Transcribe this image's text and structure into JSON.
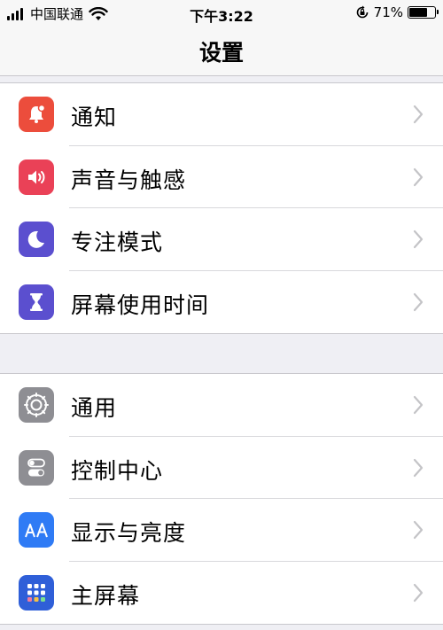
{
  "status_bar": {
    "carrier": "中国联通",
    "time": "下午3:22",
    "battery_percent_text": "71%",
    "battery_level": 0.71
  },
  "nav": {
    "title": "设置"
  },
  "groups": [
    {
      "items": [
        {
          "label": "通知",
          "icon": "notifications-icon",
          "color": "#ec4d3c"
        },
        {
          "label": "声音与触感",
          "icon": "sounds-icon",
          "color": "#ea4157"
        },
        {
          "label": "专注模式",
          "icon": "focus-moon-icon",
          "color": "#5b4fcf"
        },
        {
          "label": "屏幕使用时间",
          "icon": "screen-time-hourglass-icon",
          "color": "#5b4fcf"
        }
      ]
    },
    {
      "items": [
        {
          "label": "通用",
          "icon": "general-gear-icon",
          "color": "#8e8e93"
        },
        {
          "label": "控制中心",
          "icon": "control-center-icon",
          "color": "#8e8e93"
        },
        {
          "label": "显示与亮度",
          "icon": "display-brightness-icon",
          "color": "#2f7bf5"
        },
        {
          "label": "主屏幕",
          "icon": "home-screen-icon",
          "color": "#2f5fd8"
        }
      ]
    }
  ]
}
